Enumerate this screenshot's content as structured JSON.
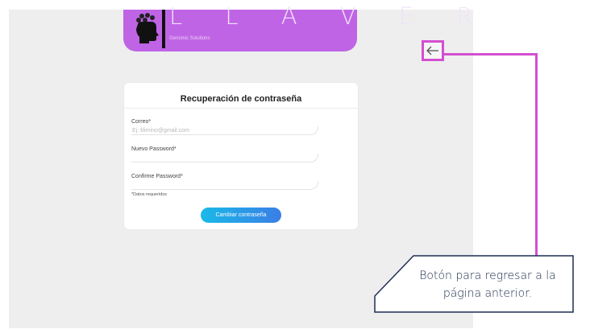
{
  "header": {
    "brand_title": "L L A V E R",
    "brand_subtitle": "Genomic Solutions"
  },
  "form": {
    "title": "Recuperación de contraseña",
    "email_label": "Correo*",
    "email_placeholder": "Ej: filimino@gmail.com",
    "new_password_label": "Nuevo Password*",
    "confirm_password_label": "Confirme Password*",
    "required_note": "*Datos requeridos",
    "submit_label": "Cambiar contraseña"
  },
  "back": {
    "icon": "arrow-left-icon",
    "glyph": "←"
  },
  "callout": {
    "line1": "Botón para regresar a la",
    "line2": "página anterior."
  },
  "colors": {
    "brand": "#c064e6",
    "highlight": "#d34fd1",
    "button_start": "#1ab9e8",
    "button_end": "#3a7ee6",
    "callout_border": "#1f2d55"
  }
}
